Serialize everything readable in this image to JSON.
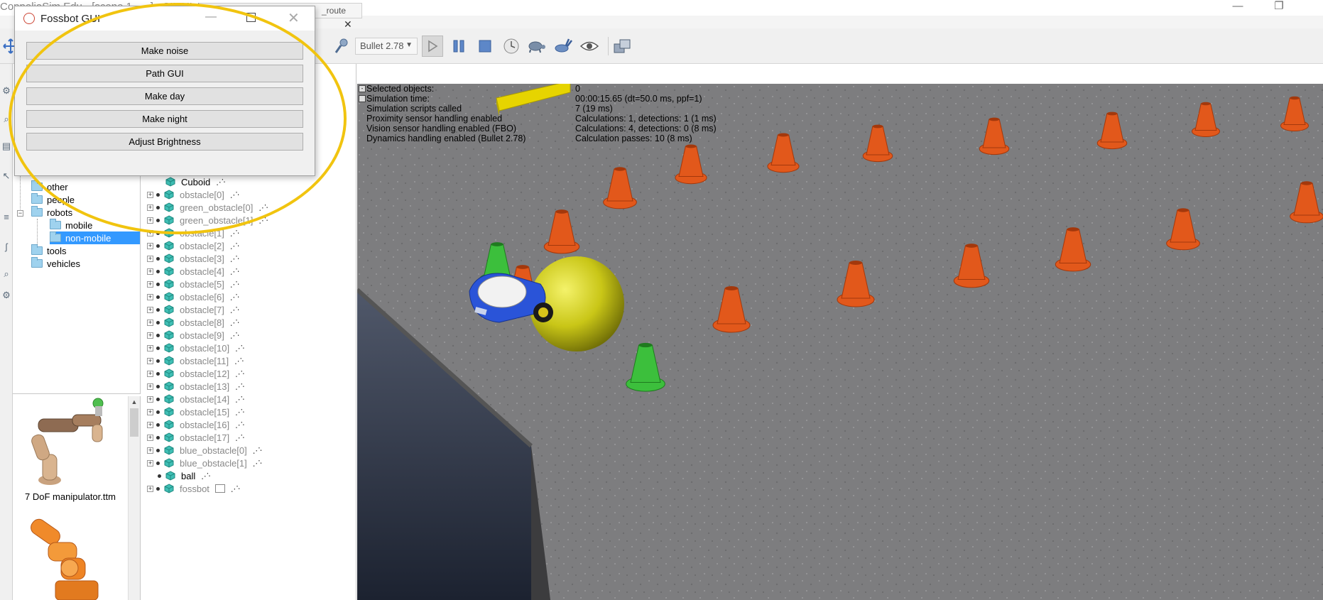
{
  "window": {
    "title": "CoppeliaSim Edu - [scene 1 - ...] - SIMULATION RUNNING",
    "min": "—",
    "max": "❐",
    "close": "✕"
  },
  "toolbar": {
    "engine_select": "Bullet 2.78"
  },
  "model_browser": {
    "folders": [
      {
        "label": "other"
      },
      {
        "label": "people"
      },
      {
        "label": "robots"
      },
      {
        "label": "mobile"
      },
      {
        "label": "non-mobile"
      },
      {
        "label": "tools"
      },
      {
        "label": "vehicles"
      }
    ],
    "thumb1_label": "7 DoF manipulator.ttm"
  },
  "hierarchy": {
    "tab_label": "_route",
    "items": [
      {
        "label": "Cuboid"
      },
      {
        "label": "obstacle[0]"
      },
      {
        "label": "green_obstacle[0]"
      },
      {
        "label": "green_obstacle[1]"
      },
      {
        "label": "obstacle[1]"
      },
      {
        "label": "obstacle[2]"
      },
      {
        "label": "obstacle[3]"
      },
      {
        "label": "obstacle[4]"
      },
      {
        "label": "obstacle[5]"
      },
      {
        "label": "obstacle[6]"
      },
      {
        "label": "obstacle[7]"
      },
      {
        "label": "obstacle[8]"
      },
      {
        "label": "obstacle[9]"
      },
      {
        "label": "obstacle[10]"
      },
      {
        "label": "obstacle[11]"
      },
      {
        "label": "obstacle[12]"
      },
      {
        "label": "obstacle[13]"
      },
      {
        "label": "obstacle[14]"
      },
      {
        "label": "obstacle[15]"
      },
      {
        "label": "obstacle[16]"
      },
      {
        "label": "obstacle[17]"
      },
      {
        "label": "blue_obstacle[0]"
      },
      {
        "label": "blue_obstacle[1]"
      },
      {
        "label": "ball"
      },
      {
        "label": "fossbot"
      }
    ]
  },
  "info": {
    "rows": [
      {
        "key": "Selected objects:",
        "value": "0"
      },
      {
        "key": "Simulation time:",
        "value": "00:00:15.65 (dt=50.0 ms, ppf=1)"
      },
      {
        "key": "Simulation scripts called",
        "value": "7 (19 ms)"
      },
      {
        "key": "Proximity sensor handling enabled",
        "value": "Calculations: 1, detections: 1 (1 ms)"
      },
      {
        "key": "Vision sensor handling enabled (FBO)",
        "value": "Calculations: 4, detections: 0 (8 ms)"
      },
      {
        "key": "Dynamics handling enabled (Bullet 2.78)",
        "value": "Calculation passes: 10 (8 ms)"
      }
    ]
  },
  "dialog": {
    "title": "Fossbot GUI",
    "buttons": [
      {
        "label": "Make noise"
      },
      {
        "label": "Path GUI"
      },
      {
        "label": "Make day"
      },
      {
        "label": "Make night"
      },
      {
        "label": "Adjust Brightness"
      }
    ]
  },
  "colors": {
    "highlight": "#f1c40f",
    "selection": "#3399ff",
    "cone_orange": "#e2581b",
    "cone_green": "#3cbf3c",
    "ball_yellow": "#d4d21a",
    "robot_blue": "#2a54d8",
    "floor": "#7f7f80"
  }
}
